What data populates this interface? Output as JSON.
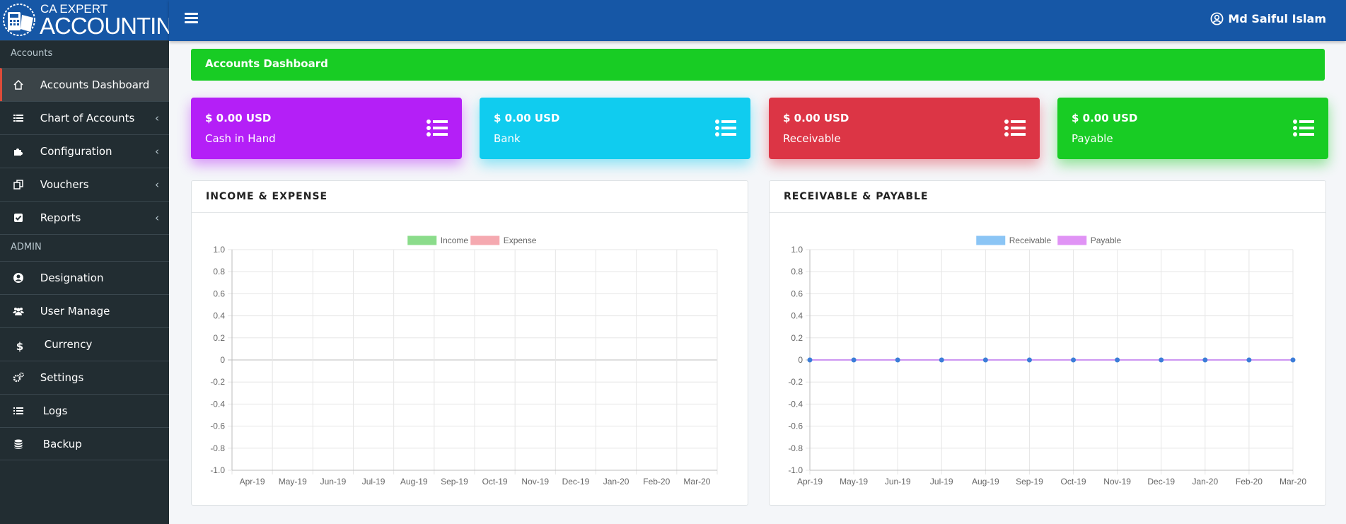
{
  "brand": {
    "line1": "CA EXPERT",
    "line2": "ACCOUNTING"
  },
  "sidebar": {
    "section1": "Accounts",
    "section2": "ADMIN",
    "items": [
      {
        "label": "Accounts Dashboard",
        "icon": "home-icon"
      },
      {
        "label": "Chart of Accounts",
        "icon": "table-icon",
        "chevron": "‹"
      },
      {
        "label": "Configuration",
        "icon": "puzzle-icon",
        "chevron": "‹"
      },
      {
        "label": "Vouchers",
        "icon": "copy-icon",
        "chevron": "‹"
      },
      {
        "label": "Reports",
        "icon": "check-square-icon",
        "chevron": "‹"
      },
      {
        "label": "Designation",
        "icon": "user-circle-icon"
      },
      {
        "label": "User Manage",
        "icon": "users-icon"
      },
      {
        "label": "Currency",
        "icon": "dollar-icon"
      },
      {
        "label": "Settings",
        "icon": "cogs-icon"
      },
      {
        "label": "Logs",
        "icon": "list-icon"
      },
      {
        "label": "Backup",
        "icon": "database-icon"
      }
    ]
  },
  "header": {
    "user": "Md Saiful Islam"
  },
  "title": "Accounts Dashboard",
  "cards": [
    {
      "amount": "$ 0.00 USD",
      "label": "Cash in Hand",
      "color": "#b41ff7"
    },
    {
      "amount": "$ 0.00 USD",
      "label": "Bank",
      "color": "#10ccef"
    },
    {
      "amount": "$ 0.00 USD",
      "label": "Receivable",
      "color": "#dc3545"
    },
    {
      "amount": "$ 0.00 USD",
      "label": "Payable",
      "color": "#18cc24"
    }
  ],
  "chart_data": [
    {
      "type": "bar",
      "title": "INCOME & EXPENSE",
      "categories": [
        "Apr-19",
        "May-19",
        "Jun-19",
        "Jul-19",
        "Aug-19",
        "Sep-19",
        "Oct-19",
        "Nov-19",
        "Dec-19",
        "Jan-20",
        "Feb-20",
        "Mar-20"
      ],
      "series": [
        {
          "name": "Income",
          "values": [
            0,
            0,
            0,
            0,
            0,
            0,
            0,
            0,
            0,
            0,
            0,
            0
          ],
          "color": "#7fd97f"
        },
        {
          "name": "Expense",
          "values": [
            0,
            0,
            0,
            0,
            0,
            0,
            0,
            0,
            0,
            0,
            0,
            0
          ],
          "color": "#f5a0a8"
        }
      ],
      "ylim": [
        -1,
        1
      ],
      "yticks": [
        "1.0",
        "0.8",
        "0.6",
        "0.4",
        "0.2",
        "0",
        "-0.2",
        "-0.4",
        "-0.6",
        "-0.8",
        "-1.0"
      ],
      "legend": "top-center",
      "grid": true
    },
    {
      "type": "line",
      "title": "RECEIVABLE & PAYABLE",
      "categories": [
        "Apr-19",
        "May-19",
        "Jun-19",
        "Jul-19",
        "Aug-19",
        "Sep-19",
        "Oct-19",
        "Nov-19",
        "Dec-19",
        "Jan-20",
        "Feb-20",
        "Mar-20"
      ],
      "series": [
        {
          "name": "Receivable",
          "values": [
            0,
            0,
            0,
            0,
            0,
            0,
            0,
            0,
            0,
            0,
            0,
            0
          ],
          "color": "#7fbff5"
        },
        {
          "name": "Payable",
          "values": [
            0,
            0,
            0,
            0,
            0,
            0,
            0,
            0,
            0,
            0,
            0,
            0
          ],
          "color": "#dd88f5"
        }
      ],
      "ylim": [
        -1,
        1
      ],
      "yticks": [
        "1.0",
        "0.8",
        "0.6",
        "0.4",
        "0.2",
        "0",
        "-0.2",
        "-0.4",
        "-0.6",
        "-0.8",
        "-1.0"
      ],
      "legend": "top-center",
      "grid": true
    }
  ]
}
